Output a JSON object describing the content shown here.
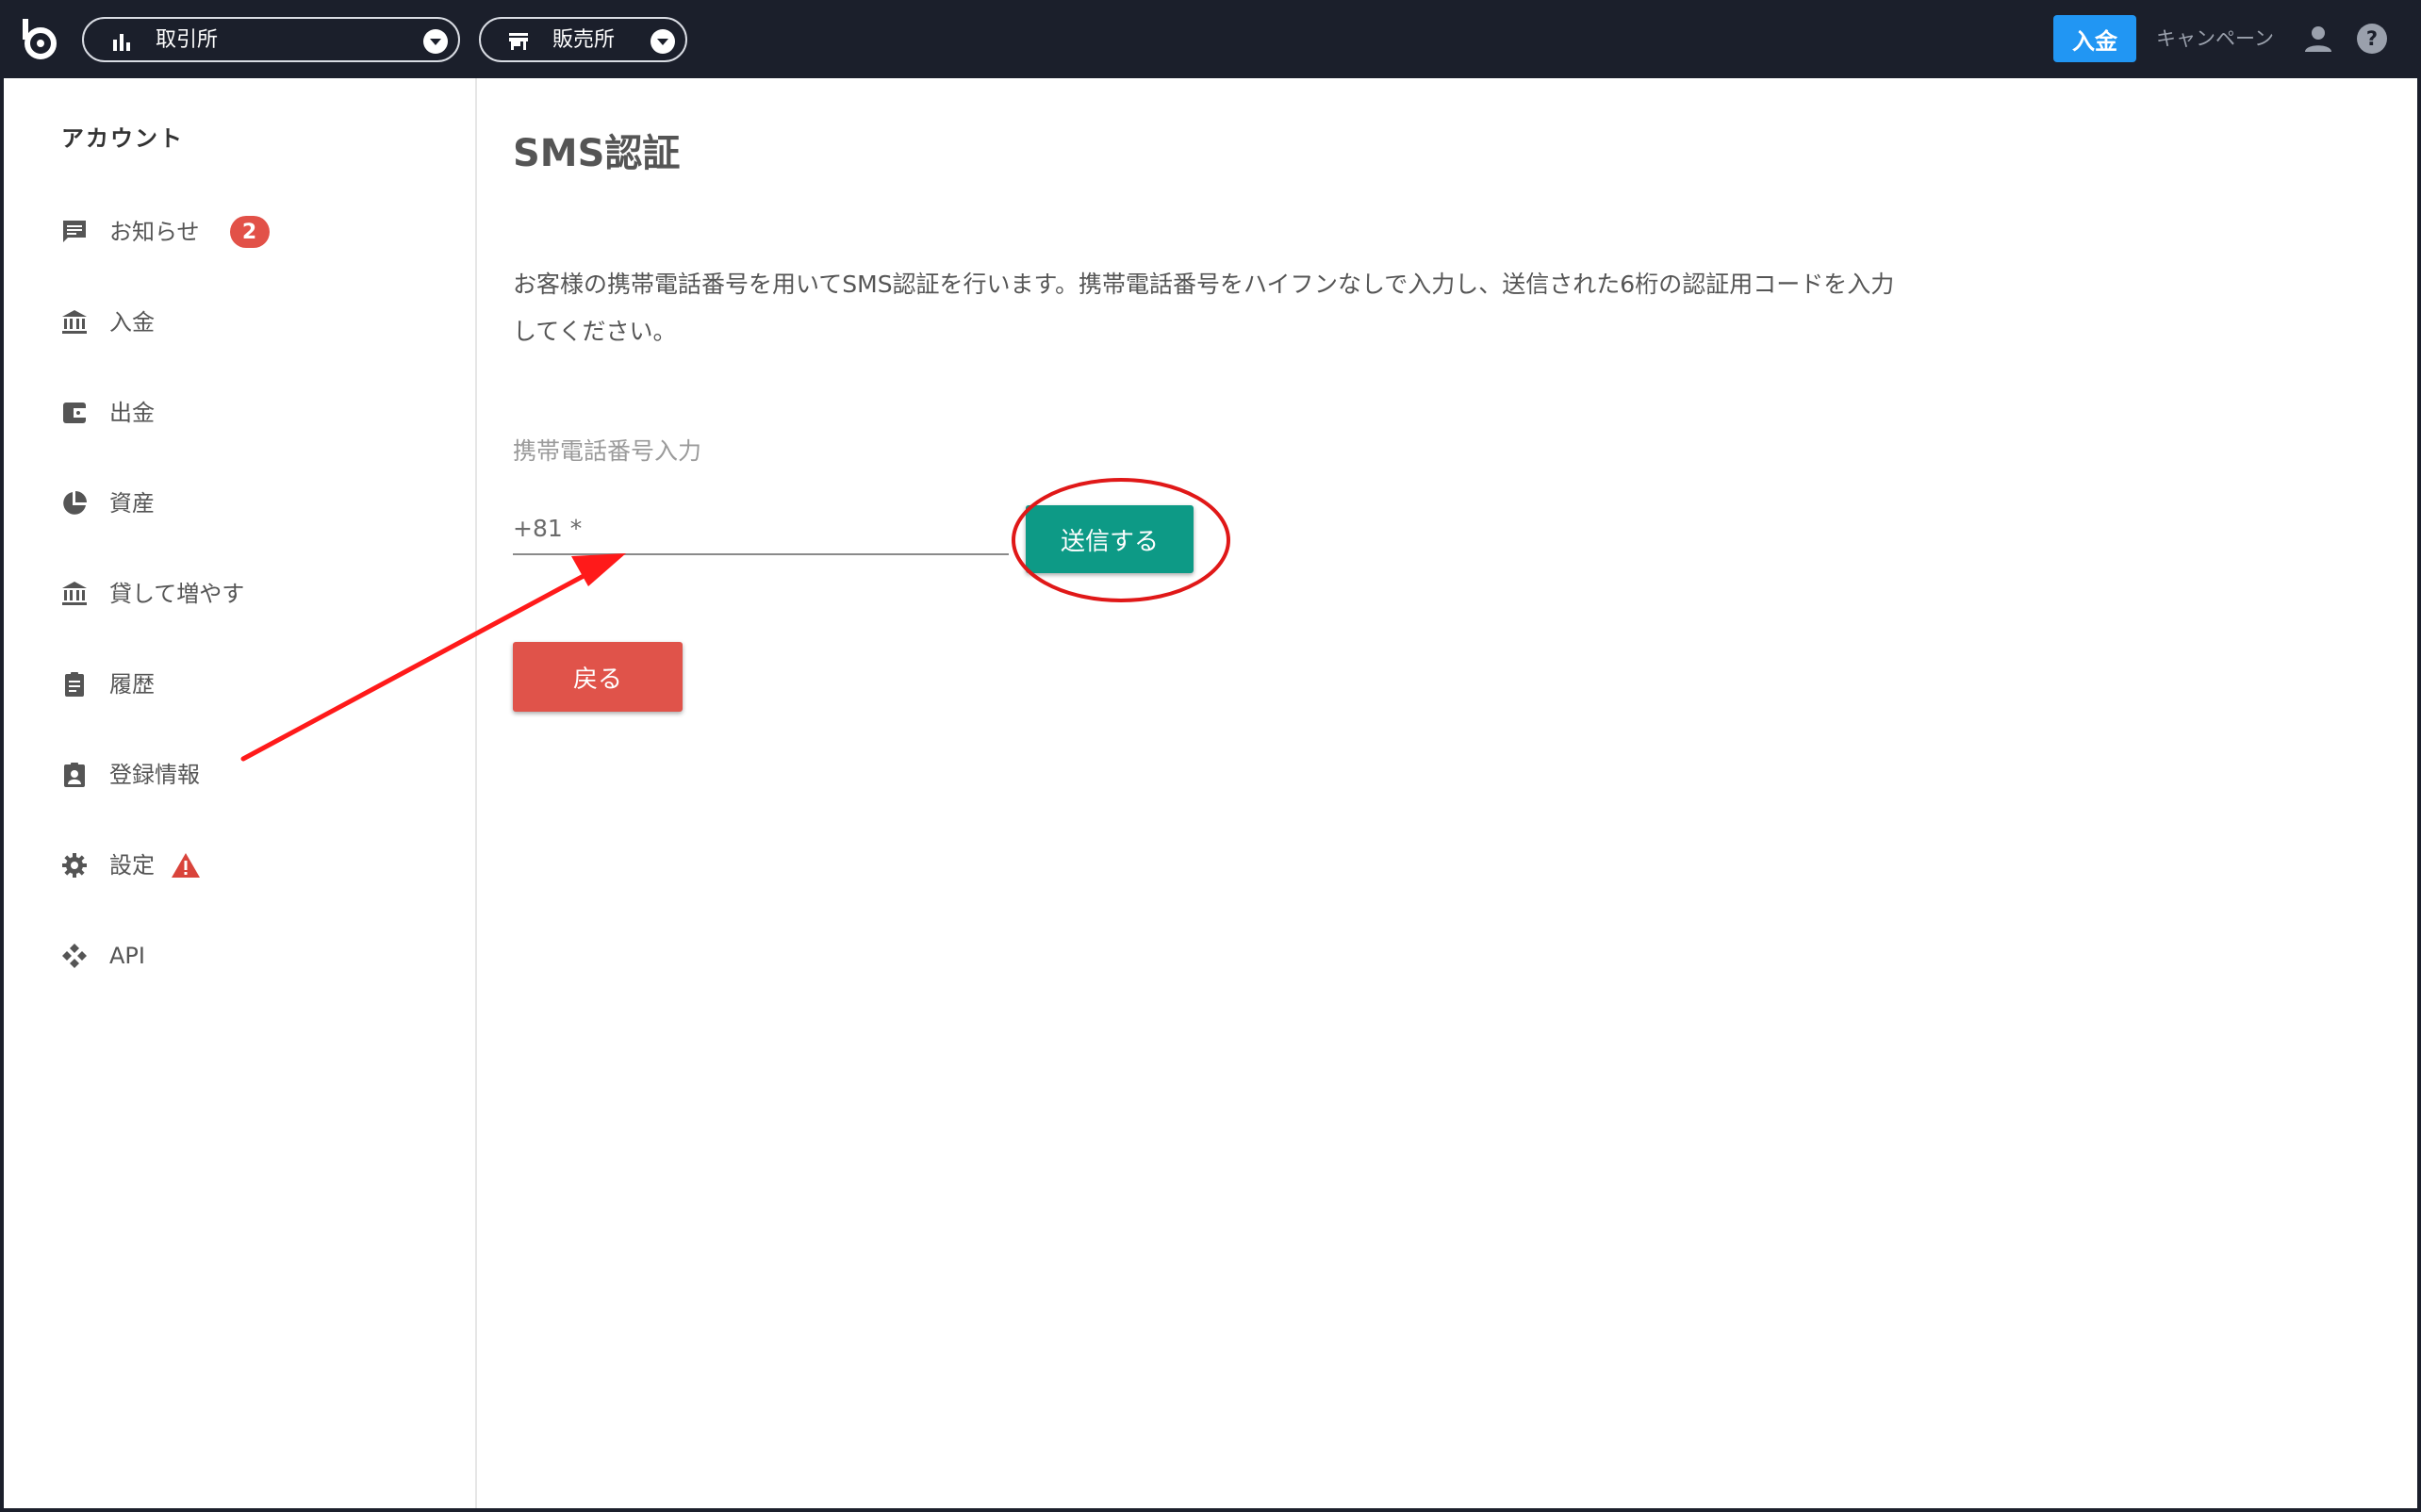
{
  "topbar": {
    "exchange_label": "取引所",
    "shop_label": "販売所",
    "deposit_label": "入金",
    "campaign_label": "キャンペーン"
  },
  "sidebar": {
    "heading": "アカウント",
    "items": [
      {
        "label": "お知らせ",
        "icon": "message-icon",
        "badge": "2"
      },
      {
        "label": "入金",
        "icon": "bank-icon"
      },
      {
        "label": "出金",
        "icon": "wallet-icon"
      },
      {
        "label": "資産",
        "icon": "pie-chart-icon"
      },
      {
        "label": "貸して増やす",
        "icon": "bank-icon"
      },
      {
        "label": "履歴",
        "icon": "clipboard-icon"
      },
      {
        "label": "登録情報",
        "icon": "account-box-icon"
      },
      {
        "label": "設定",
        "icon": "gear-icon",
        "warning_icon": "warning-icon"
      },
      {
        "label": "API",
        "icon": "api-icon"
      }
    ]
  },
  "main": {
    "title": "SMS認証",
    "description": "お客様の携帯電話番号を用いてSMS認証を行います。携帯電話番号をハイフンなしで入力し、送信された6桁の認証用コードを入力してください。",
    "phone_label": "携帯電話番号入力",
    "phone_placeholder": "+81 *",
    "phone_value": "",
    "send_label": "送信する",
    "back_label": "戻る"
  },
  "colors": {
    "topbar_bg": "#1b1f2b",
    "deposit_blue": "#2196f3",
    "send_teal": "#0d9a86",
    "back_red": "#e0534a",
    "badge_red": "#e25148",
    "annotation_red": "#ff1a1a"
  }
}
